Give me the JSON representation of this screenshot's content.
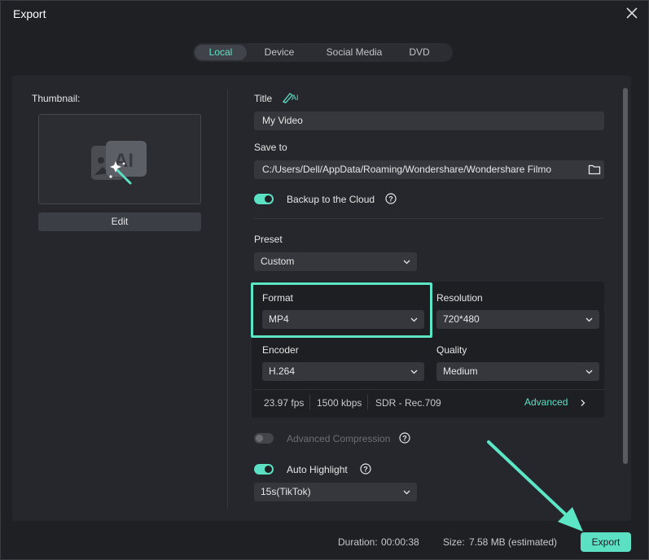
{
  "window": {
    "title": "Export"
  },
  "tabs": [
    {
      "label": "Local",
      "active": true
    },
    {
      "label": "Device",
      "active": false
    },
    {
      "label": "Social Media",
      "active": false
    },
    {
      "label": "DVD",
      "active": false
    }
  ],
  "thumbnail": {
    "label": "Thumbnail:",
    "edit_label": "Edit",
    "icon": "ai-thumbnail-icon"
  },
  "title_field": {
    "label": "Title",
    "value": "My Video",
    "ai_icon_text": "AI"
  },
  "save_to": {
    "label": "Save to",
    "value": "C:/Users/Dell/AppData/Roaming/Wondershare/Wondershare Filmo"
  },
  "backup": {
    "label": "Backup to the Cloud",
    "enabled": true
  },
  "preset": {
    "label": "Preset",
    "value": "Custom"
  },
  "format": {
    "label": "Format",
    "value": "MP4"
  },
  "resolution": {
    "label": "Resolution",
    "value": "720*480"
  },
  "encoder": {
    "label": "Encoder",
    "value": "H.264"
  },
  "quality": {
    "label": "Quality",
    "value": "Medium"
  },
  "specs": {
    "fps": "23.97 fps",
    "bitrate": "1500 kbps",
    "color": "SDR - Rec.709",
    "advanced_label": "Advanced"
  },
  "advanced_compression": {
    "label": "Advanced Compression",
    "enabled": false
  },
  "auto_highlight": {
    "label": "Auto Highlight",
    "enabled": true,
    "value": "15s(TikTok)"
  },
  "footer": {
    "duration_label": "Duration:",
    "duration": "00:00:38",
    "size_label": "Size:",
    "size": "7.58 MB (estimated)",
    "export_label": "Export"
  },
  "colors": {
    "accent": "#5ce0c4",
    "background": "#1f2024",
    "panel": "#26272c"
  }
}
